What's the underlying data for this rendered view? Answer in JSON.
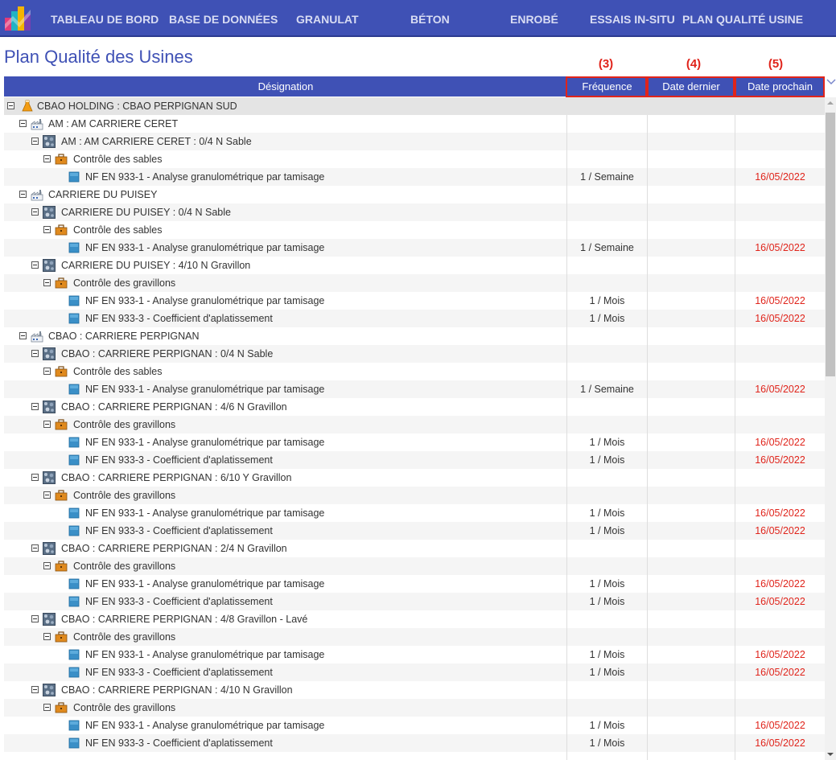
{
  "nav": {
    "items": [
      {
        "label": "TABLEAU DE BORD"
      },
      {
        "label": "BASE DE DONNÉES"
      },
      {
        "label": "GRANULAT"
      },
      {
        "label": "BÉTON"
      },
      {
        "label": "ENROBÉ"
      },
      {
        "label": "ESSAIS IN-SITU"
      },
      {
        "label": "PLAN QUALITÉ USINE"
      }
    ]
  },
  "page": {
    "title": "Plan Qualité des Usines"
  },
  "annotations": [
    "(3)",
    "(4)",
    "(5)"
  ],
  "columns": {
    "designation": "Désignation",
    "frequence": "Fréquence",
    "date_dernier": "Date dernier",
    "date_prochain": "Date prochain"
  },
  "colors": {
    "accent": "#3f51b5",
    "alert": "#e0241b"
  },
  "rows": [
    {
      "level": 0,
      "type": "holding",
      "icon": "flask-icon",
      "label": "CBAO HOLDING : CBAO PERPIGNAN SUD"
    },
    {
      "level": 1,
      "type": "site",
      "icon": "factory-icon",
      "label": "AM : AM CARRIERE CERET"
    },
    {
      "level": 2,
      "type": "product",
      "icon": "aggregate-icon",
      "label": "AM : AM CARRIERE CERET : 0/4 N Sable"
    },
    {
      "level": 3,
      "type": "control",
      "icon": "briefcase-icon",
      "label": "Contrôle des sables"
    },
    {
      "level": 4,
      "type": "test",
      "icon": "test-square-icon",
      "label": "NF EN 933-1 - Analyse granulométrique par tamisage",
      "freq": "1 / Semaine",
      "next": "16/05/2022"
    },
    {
      "level": 1,
      "type": "site",
      "icon": "factory-icon",
      "label": "CARRIERE DU PUISEY"
    },
    {
      "level": 2,
      "type": "product",
      "icon": "aggregate-icon",
      "label": "CARRIERE DU PUISEY : 0/4 N Sable"
    },
    {
      "level": 3,
      "type": "control",
      "icon": "briefcase-icon",
      "label": "Contrôle des sables"
    },
    {
      "level": 4,
      "type": "test",
      "icon": "test-square-icon",
      "label": "NF EN 933-1 - Analyse granulométrique par tamisage",
      "freq": "1 / Semaine",
      "next": "16/05/2022"
    },
    {
      "level": 2,
      "type": "product",
      "icon": "aggregate-icon",
      "label": "CARRIERE DU PUISEY : 4/10 N Gravillon"
    },
    {
      "level": 3,
      "type": "control",
      "icon": "briefcase-icon",
      "label": "Contrôle des gravillons"
    },
    {
      "level": 4,
      "type": "test",
      "icon": "test-square-icon",
      "label": "NF EN 933-1 - Analyse granulométrique par tamisage",
      "freq": "1 / Mois",
      "next": "16/05/2022"
    },
    {
      "level": 4,
      "type": "test",
      "icon": "test-square-icon",
      "label": "NF EN 933-3 - Coefficient d'aplatissement",
      "freq": "1 / Mois",
      "next": "16/05/2022"
    },
    {
      "level": 1,
      "type": "site",
      "icon": "factory-icon",
      "label": "CBAO : CARRIERE PERPIGNAN"
    },
    {
      "level": 2,
      "type": "product",
      "icon": "aggregate-icon",
      "label": "CBAO : CARRIERE PERPIGNAN : 0/4 N Sable"
    },
    {
      "level": 3,
      "type": "control",
      "icon": "briefcase-icon",
      "label": "Contrôle des sables"
    },
    {
      "level": 4,
      "type": "test",
      "icon": "test-square-icon",
      "label": "NF EN 933-1 - Analyse granulométrique par tamisage",
      "freq": "1 / Semaine",
      "next": "16/05/2022"
    },
    {
      "level": 2,
      "type": "product",
      "icon": "aggregate-icon",
      "label": "CBAO : CARRIERE PERPIGNAN : 4/6 N Gravillon"
    },
    {
      "level": 3,
      "type": "control",
      "icon": "briefcase-icon",
      "label": "Contrôle des gravillons"
    },
    {
      "level": 4,
      "type": "test",
      "icon": "test-square-icon",
      "label": "NF EN 933-1 - Analyse granulométrique par tamisage",
      "freq": "1 / Mois",
      "next": "16/05/2022"
    },
    {
      "level": 4,
      "type": "test",
      "icon": "test-square-icon",
      "label": "NF EN 933-3 - Coefficient d'aplatissement",
      "freq": "1 / Mois",
      "next": "16/05/2022"
    },
    {
      "level": 2,
      "type": "product",
      "icon": "aggregate-icon",
      "label": "CBAO : CARRIERE PERPIGNAN : 6/10 Y Gravillon"
    },
    {
      "level": 3,
      "type": "control",
      "icon": "briefcase-icon",
      "label": "Contrôle des gravillons"
    },
    {
      "level": 4,
      "type": "test",
      "icon": "test-square-icon",
      "label": "NF EN 933-1 - Analyse granulométrique par tamisage",
      "freq": "1 / Mois",
      "next": "16/05/2022"
    },
    {
      "level": 4,
      "type": "test",
      "icon": "test-square-icon",
      "label": "NF EN 933-3 - Coefficient d'aplatissement",
      "freq": "1 / Mois",
      "next": "16/05/2022"
    },
    {
      "level": 2,
      "type": "product",
      "icon": "aggregate-icon",
      "label": "CBAO : CARRIERE PERPIGNAN : 2/4 N Gravillon"
    },
    {
      "level": 3,
      "type": "control",
      "icon": "briefcase-icon",
      "label": "Contrôle des gravillons"
    },
    {
      "level": 4,
      "type": "test",
      "icon": "test-square-icon",
      "label": "NF EN 933-1 - Analyse granulométrique par tamisage",
      "freq": "1 / Mois",
      "next": "16/05/2022"
    },
    {
      "level": 4,
      "type": "test",
      "icon": "test-square-icon",
      "label": "NF EN 933-3 - Coefficient d'aplatissement",
      "freq": "1 / Mois",
      "next": "16/05/2022"
    },
    {
      "level": 2,
      "type": "product",
      "icon": "aggregate-icon",
      "label": "CBAO : CARRIERE PERPIGNAN : 4/8 Gravillon - Lavé"
    },
    {
      "level": 3,
      "type": "control",
      "icon": "briefcase-icon",
      "label": "Contrôle des gravillons"
    },
    {
      "level": 4,
      "type": "test",
      "icon": "test-square-icon",
      "label": "NF EN 933-1 - Analyse granulométrique par tamisage",
      "freq": "1 / Mois",
      "next": "16/05/2022"
    },
    {
      "level": 4,
      "type": "test",
      "icon": "test-square-icon",
      "label": "NF EN 933-3 - Coefficient d'aplatissement",
      "freq": "1 / Mois",
      "next": "16/05/2022"
    },
    {
      "level": 2,
      "type": "product",
      "icon": "aggregate-icon",
      "label": "CBAO : CARRIERE PERPIGNAN : 4/10 N Gravillon"
    },
    {
      "level": 3,
      "type": "control",
      "icon": "briefcase-icon",
      "label": "Contrôle des gravillons"
    },
    {
      "level": 4,
      "type": "test",
      "icon": "test-square-icon",
      "label": "NF EN 933-1 - Analyse granulométrique par tamisage",
      "freq": "1 / Mois",
      "next": "16/05/2022"
    },
    {
      "level": 4,
      "type": "test",
      "icon": "test-square-icon",
      "label": "NF EN 933-3 - Coefficient d'aplatissement",
      "freq": "1 / Mois",
      "next": "16/05/2022"
    }
  ]
}
